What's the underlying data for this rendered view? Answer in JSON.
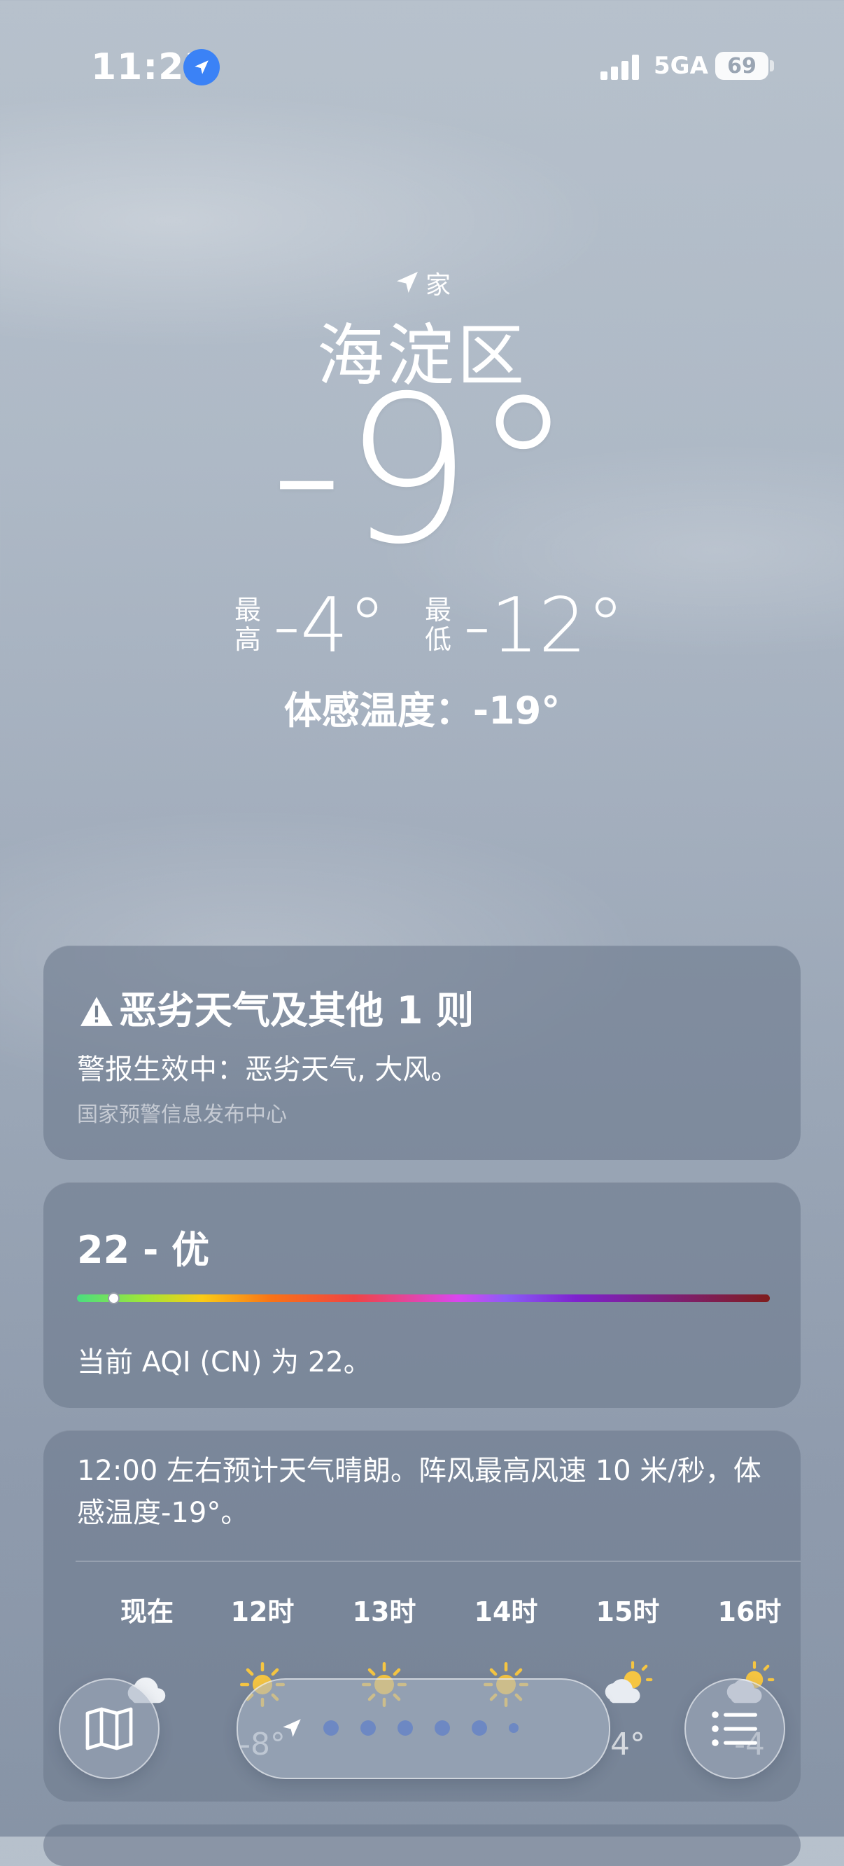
{
  "status_bar": {
    "time": "11:23",
    "network": "5GA",
    "battery": "69",
    "signal_bars": 4
  },
  "location": {
    "label": "家",
    "city": "海淀区"
  },
  "current": {
    "temperature": "-9°",
    "high_label_1": "最",
    "high_label_2": "高",
    "high": "-4°",
    "low_label_1": "最",
    "low_label_2": "低",
    "low": "-12°",
    "feels_like": "体感温度：-19°"
  },
  "alert": {
    "title": "恶劣天气及其他 1 则",
    "text": "警报生效中：恶劣天气, 大风。",
    "source": "国家预警信息发布中心"
  },
  "aqi": {
    "title": "22 - 优",
    "level_fraction": 0.03,
    "description": "当前 AQI (CN) 为 22。"
  },
  "hourly": {
    "summary": "12:00 左右预计天气晴朗。阵风最高风速 10 米/秒，体感温度-19°。",
    "hours": [
      {
        "label": "现在",
        "icon": "partly-cloudy-icon",
        "temp": ""
      },
      {
        "label": "12时",
        "icon": "sun-icon",
        "temp": "-8°"
      },
      {
        "label": "13时",
        "icon": "sun-icon",
        "temp": ""
      },
      {
        "label": "14时",
        "icon": "sun-icon",
        "temp": ""
      },
      {
        "label": "15时",
        "icon": "partly-sunny-icon",
        "temp": "4°"
      },
      {
        "label": "16时",
        "icon": "partly-sunny-icon",
        "temp": "-4"
      }
    ]
  },
  "bottom_bar": {
    "map_icon": "map-icon",
    "list_icon": "list-icon",
    "page_dots": 7
  },
  "colors": {
    "location_blue": "#3b82f6",
    "sun_yellow": "#f5c542",
    "card_bg": "#6e7a8e"
  }
}
